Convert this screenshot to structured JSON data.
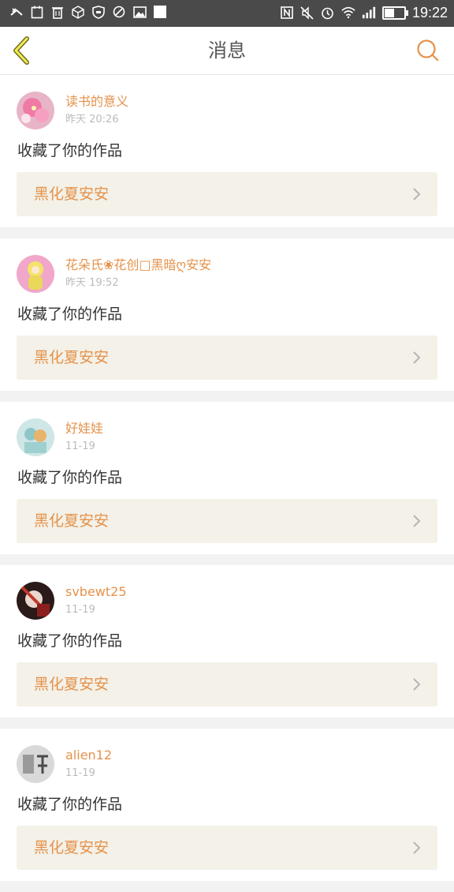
{
  "statusbar": {
    "time": "19:22",
    "left_icons": [
      "missed-call-icon",
      "calendar-icon",
      "trash-icon",
      "cube-icon",
      "shield-icon",
      "disabled-icon",
      "image-icon",
      "square-icon"
    ],
    "right_icons": [
      "nfc-icon",
      "mute-icon",
      "alarm-icon",
      "wifi-icon",
      "signal-icon",
      "battery-icon"
    ],
    "battery_level": 0.55
  },
  "header": {
    "title": "消息"
  },
  "colors": {
    "accent": "#e5924b",
    "card_work_bg": "#f3f1e8",
    "statusbar_bg": "#4a4a4a"
  },
  "messages": [
    {
      "user": "读书的意义",
      "time": "昨天 20:26",
      "action": "收藏了你的作品",
      "work": "黑化夏安安",
      "avatar": "pink-flower"
    },
    {
      "user": "花朵氏❀花创□黑暗ღ安安",
      "time": "昨天 19:52",
      "action": "收藏了你的作品",
      "work": "黑化夏安安",
      "avatar": "yellow-character"
    },
    {
      "user": "好娃娃",
      "time": "11-19",
      "action": "收藏了你的作品",
      "work": "黑化夏安安",
      "avatar": "teal-couple"
    },
    {
      "user": "svbewt25",
      "time": "11-19",
      "action": "收藏了你的作品",
      "work": "黑化夏安安",
      "avatar": "dark-portrait"
    },
    {
      "user": "alien12",
      "time": "11-19",
      "action": "收藏了你的作品",
      "work": "黑化夏安安",
      "avatar": "grey-calligraphy"
    }
  ]
}
